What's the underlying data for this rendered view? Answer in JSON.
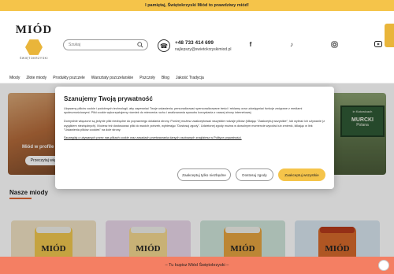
{
  "topbar": {
    "text": "I pamiętaj, Świętokrzyski Miód to prawdziwy miód!"
  },
  "logo": {
    "title": "MIÓD",
    "subtitle": "ŚWIĘTOKRZYSKI"
  },
  "search": {
    "placeholder": "Szukaj",
    "icon": "search-icon"
  },
  "contact": {
    "phone": "+48 733 414 699",
    "email": "najlepszy@swietokrzyskimiod.pl",
    "icon": "phone-icon"
  },
  "social": [
    "facebook-icon",
    "tiktok-icon",
    "instagram-icon",
    "youtube-icon"
  ],
  "nav": [
    "Miody",
    "Złote miody",
    "Produkty pszczele",
    "Warsztaty pszczelarskie",
    "Pszczoły",
    "Blog",
    "Jakość Tradycja"
  ],
  "hero": {
    "left_label": "Miód w profile",
    "left_button": "Przeczytaj więc",
    "sign_lines": [
      "MURCKI",
      "Polana"
    ],
    "sign_top": "in Katowicach"
  },
  "section": {
    "title": "Nasze miody"
  },
  "products": [
    {
      "label": "MIÓD",
      "bg": "#f1e2c4",
      "honey": "#f1c74f",
      "lid": "#f0efe9"
    },
    {
      "label": "MIÓD",
      "bg": "#ead7ea",
      "honey": "#f4d890",
      "lid": "#f0efe9"
    },
    {
      "label": "MIÓD",
      "bg": "#cfe4d9",
      "honey": "#e6a440",
      "lid": "#f0efe9"
    },
    {
      "label": "MIÓD",
      "bg": "#d8e6ef",
      "honey": "#d66a2b",
      "lid": "#b53a1c"
    }
  ],
  "modal": {
    "title": "Szanujemy Twoją prywatność",
    "para1": "Używamy plików cookie i podobnych technologii, aby zapewniać Twoje ustawienia, personalizować spersonalizowane treści i reklamy oraz udostępniać funkcje związane z mediami społecznościowymi. Pliki cookie wykorzystujemy również do mierzenia ruchu i analizowania sposobu korzystania z naszej strony internetowej.",
    "para2": "Domyślnie włączone są jedynie pliki niezbędne do poprawnego działania strony. Poniżej możesz zaakceptować wszystkie rodzaje plików (klikając \"Zaakceptuj wszystkie\", lub wybrać ich używanie (z wyjątkiem niezbędnych). Możesz też dostosować pliki do swoich potrzeb, wybierając \"Dostosuj zgody\". Udzielonej zgody można w dowolnym momencie wycofać lub zmienić, klikając w link \"Ustawienia plików cookies\" na dole strony.",
    "link": "Szczegóły o używanych przez nas plikach cookie oraz zasadach przetwarzania danych osobowych znajdziesz w Polityce prywatności.",
    "btn_necessary": "Zaakceptuj tylko niezbędne",
    "btn_customize": "Dostosuj zgody",
    "btn_accept": "Zaakceptuj wszystkie"
  },
  "bottombar": {
    "text": "– Tu kupisz Miód Świętokrzyski –"
  },
  "colors": {
    "accent": "#f5c44a",
    "coral": "#f47f63"
  }
}
